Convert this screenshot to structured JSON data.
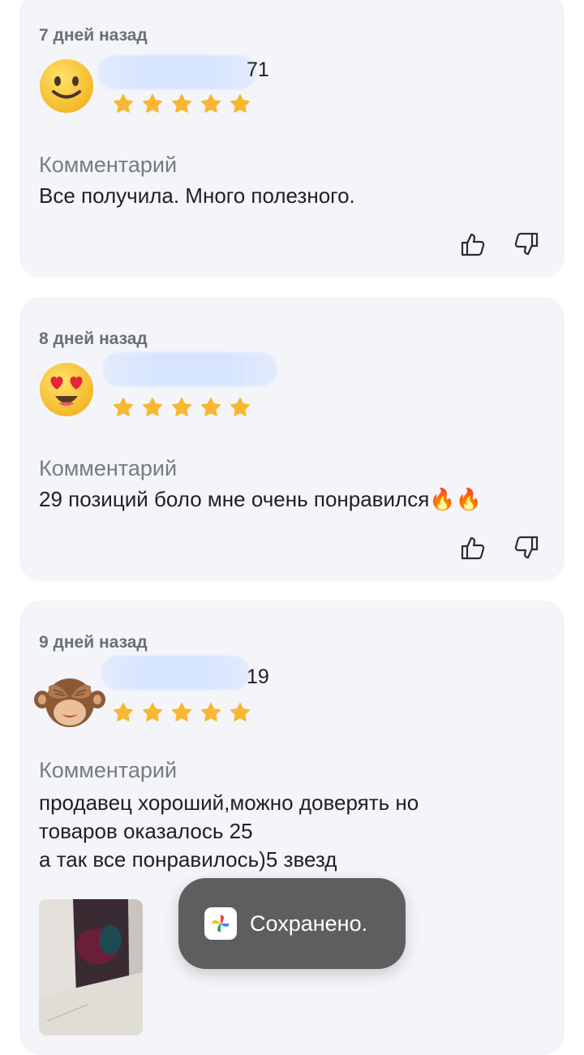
{
  "reviews": [
    {
      "date": "7 дней назад",
      "name_suffix": "71",
      "avatar": "slightly-smiling-face",
      "rating": 5,
      "comment_label": "Комментарий",
      "comment": "Все получила. Много полезного."
    },
    {
      "date": "8 дней назад",
      "name_suffix": "",
      "avatar": "heart-eyes-face",
      "rating": 5,
      "comment_label": "Комментарий",
      "comment": "29 позиций  боло мне очень понравился🔥🔥"
    },
    {
      "date": "9 дней назад",
      "name_suffix": "19",
      "avatar": "see-no-evil-monkey",
      "rating": 5,
      "comment_label": "Комментарий",
      "comment": "продавец хороший,можно доверять но\nтоваров оказалось 25\nа так все понравилось)5 звезд"
    }
  ],
  "toast": {
    "text": "Сохранено.",
    "icon": "google-photos-icon"
  },
  "colors": {
    "card_background": "#f4f5f9",
    "star": "#f7b733",
    "toast_background": "#5e5e5e"
  }
}
